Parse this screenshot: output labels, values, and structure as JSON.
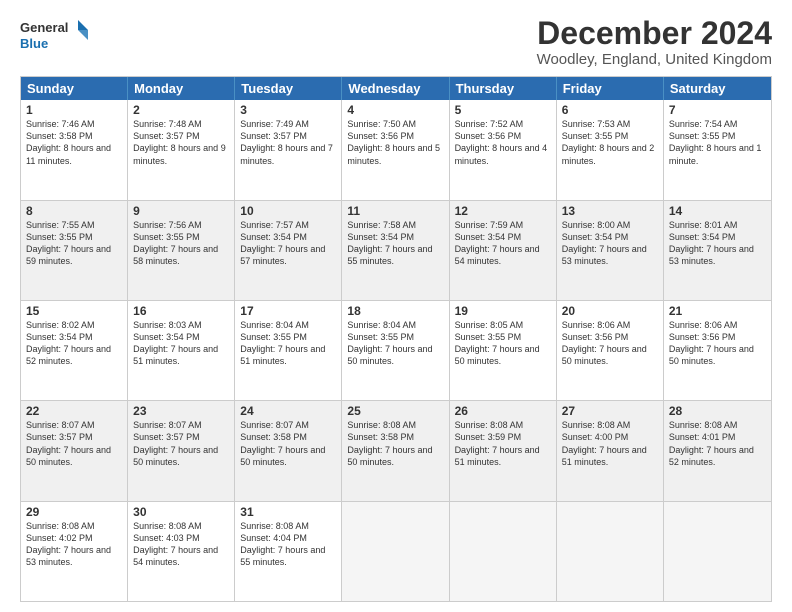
{
  "header": {
    "logo_line1": "General",
    "logo_line2": "Blue",
    "main_title": "December 2024",
    "subtitle": "Woodley, England, United Kingdom"
  },
  "calendar": {
    "days": [
      "Sunday",
      "Monday",
      "Tuesday",
      "Wednesday",
      "Thursday",
      "Friday",
      "Saturday"
    ],
    "rows": [
      [
        {
          "day": "1",
          "sunrise": "Sunrise: 7:46 AM",
          "sunset": "Sunset: 3:58 PM",
          "daylight": "Daylight: 8 hours and 11 minutes."
        },
        {
          "day": "2",
          "sunrise": "Sunrise: 7:48 AM",
          "sunset": "Sunset: 3:57 PM",
          "daylight": "Daylight: 8 hours and 9 minutes."
        },
        {
          "day": "3",
          "sunrise": "Sunrise: 7:49 AM",
          "sunset": "Sunset: 3:57 PM",
          "daylight": "Daylight: 8 hours and 7 minutes."
        },
        {
          "day": "4",
          "sunrise": "Sunrise: 7:50 AM",
          "sunset": "Sunset: 3:56 PM",
          "daylight": "Daylight: 8 hours and 5 minutes."
        },
        {
          "day": "5",
          "sunrise": "Sunrise: 7:52 AM",
          "sunset": "Sunset: 3:56 PM",
          "daylight": "Daylight: 8 hours and 4 minutes."
        },
        {
          "day": "6",
          "sunrise": "Sunrise: 7:53 AM",
          "sunset": "Sunset: 3:55 PM",
          "daylight": "Daylight: 8 hours and 2 minutes."
        },
        {
          "day": "7",
          "sunrise": "Sunrise: 7:54 AM",
          "sunset": "Sunset: 3:55 PM",
          "daylight": "Daylight: 8 hours and 1 minute."
        }
      ],
      [
        {
          "day": "8",
          "sunrise": "Sunrise: 7:55 AM",
          "sunset": "Sunset: 3:55 PM",
          "daylight": "Daylight: 7 hours and 59 minutes."
        },
        {
          "day": "9",
          "sunrise": "Sunrise: 7:56 AM",
          "sunset": "Sunset: 3:55 PM",
          "daylight": "Daylight: 7 hours and 58 minutes."
        },
        {
          "day": "10",
          "sunrise": "Sunrise: 7:57 AM",
          "sunset": "Sunset: 3:54 PM",
          "daylight": "Daylight: 7 hours and 57 minutes."
        },
        {
          "day": "11",
          "sunrise": "Sunrise: 7:58 AM",
          "sunset": "Sunset: 3:54 PM",
          "daylight": "Daylight: 7 hours and 55 minutes."
        },
        {
          "day": "12",
          "sunrise": "Sunrise: 7:59 AM",
          "sunset": "Sunset: 3:54 PM",
          "daylight": "Daylight: 7 hours and 54 minutes."
        },
        {
          "day": "13",
          "sunrise": "Sunrise: 8:00 AM",
          "sunset": "Sunset: 3:54 PM",
          "daylight": "Daylight: 7 hours and 53 minutes."
        },
        {
          "day": "14",
          "sunrise": "Sunrise: 8:01 AM",
          "sunset": "Sunset: 3:54 PM",
          "daylight": "Daylight: 7 hours and 53 minutes."
        }
      ],
      [
        {
          "day": "15",
          "sunrise": "Sunrise: 8:02 AM",
          "sunset": "Sunset: 3:54 PM",
          "daylight": "Daylight: 7 hours and 52 minutes."
        },
        {
          "day": "16",
          "sunrise": "Sunrise: 8:03 AM",
          "sunset": "Sunset: 3:54 PM",
          "daylight": "Daylight: 7 hours and 51 minutes."
        },
        {
          "day": "17",
          "sunrise": "Sunrise: 8:04 AM",
          "sunset": "Sunset: 3:55 PM",
          "daylight": "Daylight: 7 hours and 51 minutes."
        },
        {
          "day": "18",
          "sunrise": "Sunrise: 8:04 AM",
          "sunset": "Sunset: 3:55 PM",
          "daylight": "Daylight: 7 hours and 50 minutes."
        },
        {
          "day": "19",
          "sunrise": "Sunrise: 8:05 AM",
          "sunset": "Sunset: 3:55 PM",
          "daylight": "Daylight: 7 hours and 50 minutes."
        },
        {
          "day": "20",
          "sunrise": "Sunrise: 8:06 AM",
          "sunset": "Sunset: 3:56 PM",
          "daylight": "Daylight: 7 hours and 50 minutes."
        },
        {
          "day": "21",
          "sunrise": "Sunrise: 8:06 AM",
          "sunset": "Sunset: 3:56 PM",
          "daylight": "Daylight: 7 hours and 50 minutes."
        }
      ],
      [
        {
          "day": "22",
          "sunrise": "Sunrise: 8:07 AM",
          "sunset": "Sunset: 3:57 PM",
          "daylight": "Daylight: 7 hours and 50 minutes."
        },
        {
          "day": "23",
          "sunrise": "Sunrise: 8:07 AM",
          "sunset": "Sunset: 3:57 PM",
          "daylight": "Daylight: 7 hours and 50 minutes."
        },
        {
          "day": "24",
          "sunrise": "Sunrise: 8:07 AM",
          "sunset": "Sunset: 3:58 PM",
          "daylight": "Daylight: 7 hours and 50 minutes."
        },
        {
          "day": "25",
          "sunrise": "Sunrise: 8:08 AM",
          "sunset": "Sunset: 3:58 PM",
          "daylight": "Daylight: 7 hours and 50 minutes."
        },
        {
          "day": "26",
          "sunrise": "Sunrise: 8:08 AM",
          "sunset": "Sunset: 3:59 PM",
          "daylight": "Daylight: 7 hours and 51 minutes."
        },
        {
          "day": "27",
          "sunrise": "Sunrise: 8:08 AM",
          "sunset": "Sunset: 4:00 PM",
          "daylight": "Daylight: 7 hours and 51 minutes."
        },
        {
          "day": "28",
          "sunrise": "Sunrise: 8:08 AM",
          "sunset": "Sunset: 4:01 PM",
          "daylight": "Daylight: 7 hours and 52 minutes."
        }
      ],
      [
        {
          "day": "29",
          "sunrise": "Sunrise: 8:08 AM",
          "sunset": "Sunset: 4:02 PM",
          "daylight": "Daylight: 7 hours and 53 minutes."
        },
        {
          "day": "30",
          "sunrise": "Sunrise: 8:08 AM",
          "sunset": "Sunset: 4:03 PM",
          "daylight": "Daylight: 7 hours and 54 minutes."
        },
        {
          "day": "31",
          "sunrise": "Sunrise: 8:08 AM",
          "sunset": "Sunset: 4:04 PM",
          "daylight": "Daylight: 7 hours and 55 minutes."
        },
        null,
        null,
        null,
        null
      ]
    ]
  }
}
